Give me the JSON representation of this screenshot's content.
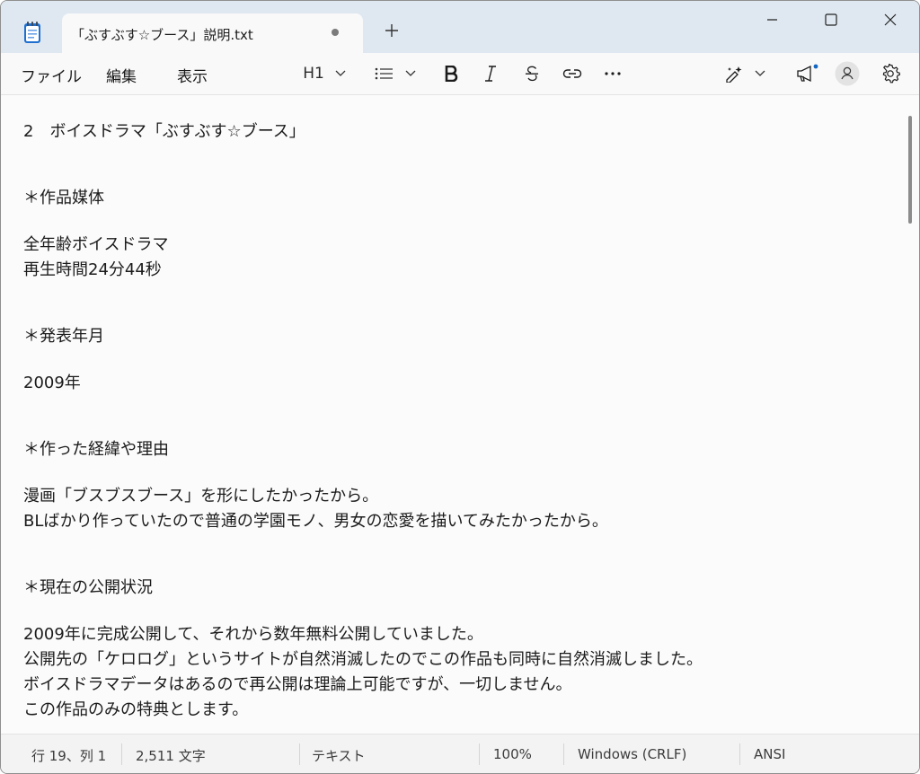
{
  "tab": {
    "title": "「ぶすぶす☆ブース」説明.txt"
  },
  "menu": {
    "file": "ファイル",
    "edit": "編集",
    "view": "表示"
  },
  "toolbar": {
    "heading": "H1"
  },
  "content": {
    "lines": [
      "2　ボイスドラマ「ぶすぶす☆ブース」",
      "＊作品媒体",
      "全年齢ボイスドラマ",
      "再生時間24分44秒",
      "＊発表年月",
      "2009年",
      "＊作った経緯や理由",
      "漫画「ブスブスブース」を形にしたかったから。",
      "BLばかり作っていたので普通の学園モノ、男女の恋愛を描いてみたかったから。",
      "＊現在の公開状況",
      "2009年に完成公開して、それから数年無料公開していました。",
      "公開先の「ケロログ」というサイトが自然消滅したのでこの作品も同時に自然消滅しました。",
      "ボイスドラマデータはあるので再公開は理論上可能ですが、一切しません。",
      "この作品のみの特典とします。"
    ]
  },
  "status": {
    "position": "行 19、列 1",
    "chars": "2,511 文字",
    "format": "テキスト",
    "zoom": "100%",
    "line_ending": "Windows (CRLF)",
    "encoding": "ANSI"
  },
  "icons": {
    "app": "notepad-icon",
    "close_tab": "unsaved-dot-icon",
    "new_tab": "plus-icon",
    "bold": "bold-icon",
    "italic": "italic-icon",
    "strike": "strikethrough-icon",
    "link": "link-icon",
    "more": "more-icon",
    "copilot": "copilot-icon",
    "feedback": "megaphone-icon",
    "account": "account-icon",
    "settings": "gear-icon"
  }
}
